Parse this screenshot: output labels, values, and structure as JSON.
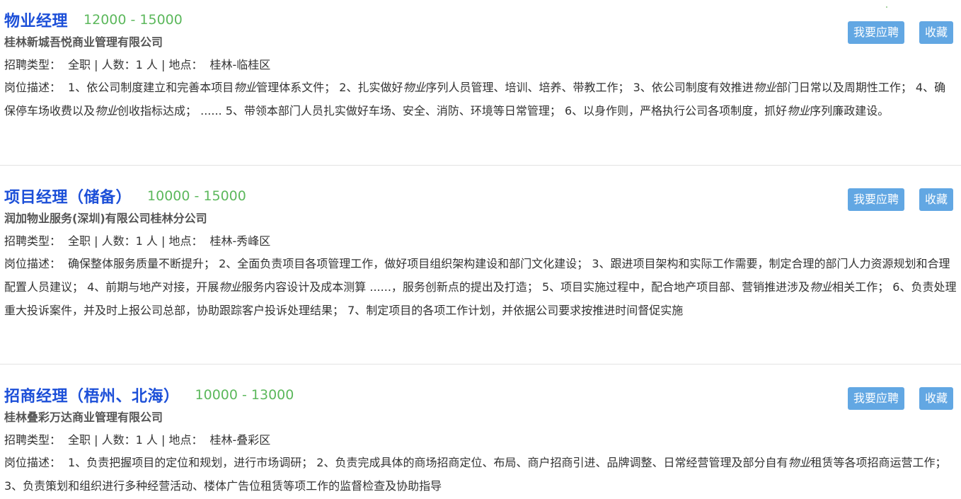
{
  "jobs": [
    {
      "title": "物业经理",
      "salary": "12000 - 15000",
      "company": "桂林新城吾悦商业管理有限公司",
      "meta": {
        "type_label": "招聘类型：",
        "type_value": "全职",
        "sep": "|",
        "count_label": "人数：",
        "count_value": "1 人",
        "loc_label": "地点：",
        "loc_value": "桂林-临桂区"
      },
      "desc_label": "岗位描述：",
      "desc": [
        {
          "text": "1、依公司制度建立和完善本项目",
          "em": false
        },
        {
          "text": "物业",
          "em": true
        },
        {
          "text": "管理体系文件； 2、扎实做好",
          "em": false
        },
        {
          "text": "物业",
          "em": true
        },
        {
          "text": "序列人员管理、培训、培养、带教工作； 3、依公司制度有效推进",
          "em": false
        },
        {
          "text": "物业",
          "em": true
        },
        {
          "text": "部门日常以及周期性工作； 4、确保停车场收费以及",
          "em": false
        },
        {
          "text": "物业",
          "em": true
        },
        {
          "text": "创收指标达成； ...... 5、带领本部门人员扎实做好车场、安全、消防、环境等日常管理； 6、以身作则，严格执行公司各项制度，抓好",
          "em": false
        },
        {
          "text": "物业",
          "em": true
        },
        {
          "text": "序列廉政建设。",
          "em": false
        }
      ],
      "apply_label": "我要应聘",
      "fav_label": "收藏"
    },
    {
      "title": "项目经理（储备）",
      "salary": "10000 - 15000",
      "company": "润加物业服务(深圳)有限公司桂林分公司",
      "meta": {
        "type_label": "招聘类型：",
        "type_value": "全职",
        "sep": "|",
        "count_label": "人数：",
        "count_value": "1 人",
        "loc_label": "地点：",
        "loc_value": "桂林-秀峰区"
      },
      "desc_label": "岗位描述：",
      "desc": [
        {
          "text": "确保整体服务质量不断提升； 2、全面负责项目各项管理工作，做好项目组织架构建设和部门文化建设； 3、跟进项目架构和实际工作需要，制定合理的部门人力资源规划和合理配置人员建议； 4、前期与地产对接，开展",
          "em": false
        },
        {
          "text": "物业",
          "em": true
        },
        {
          "text": "服务内容设计及成本测算 ......，服务创新点的提出及打造； 5、项目实施过程中，配合地产项目部、营销推进涉及",
          "em": false
        },
        {
          "text": "物业",
          "em": true
        },
        {
          "text": "相关工作； 6、负责处理重大投诉案件，并及时上报公司总部，协助跟踪客户投诉处理结果； 7、制定项目的各项工作计划，并依据公司要求按推进时间督促实施",
          "em": false
        }
      ],
      "apply_label": "我要应聘",
      "fav_label": "收藏"
    },
    {
      "title": "招商经理（梧州、北海）",
      "salary": "10000 - 13000",
      "company": "桂林叠彩万达商业管理有限公司",
      "meta": {
        "type_label": "招聘类型：",
        "type_value": "全职",
        "sep": "|",
        "count_label": "人数：",
        "count_value": "1 人",
        "loc_label": "地点：",
        "loc_value": "桂林-叠彩区"
      },
      "desc_label": "岗位描述：",
      "desc": [
        {
          "text": "1、负责把握项目的定位和规划，进行市场调研； 2、负责完成具体的商场招商定位、布局、商户招商引进、品牌调整、日常经营管理及部分自有",
          "em": false
        },
        {
          "text": "物业",
          "em": true
        },
        {
          "text": "租赁等各项招商运营工作； 3、负责策划和组织进行多种经营活动、楼体广告位租赁等项工作的监督检查及协助指导",
          "em": false
        }
      ],
      "apply_label": "我要应聘",
      "fav_label": "收藏"
    }
  ],
  "colors": {
    "title": "#1c4fd8",
    "salary": "#5cb85c",
    "button": "#62a7e3",
    "divider": "#e3e3e3"
  }
}
